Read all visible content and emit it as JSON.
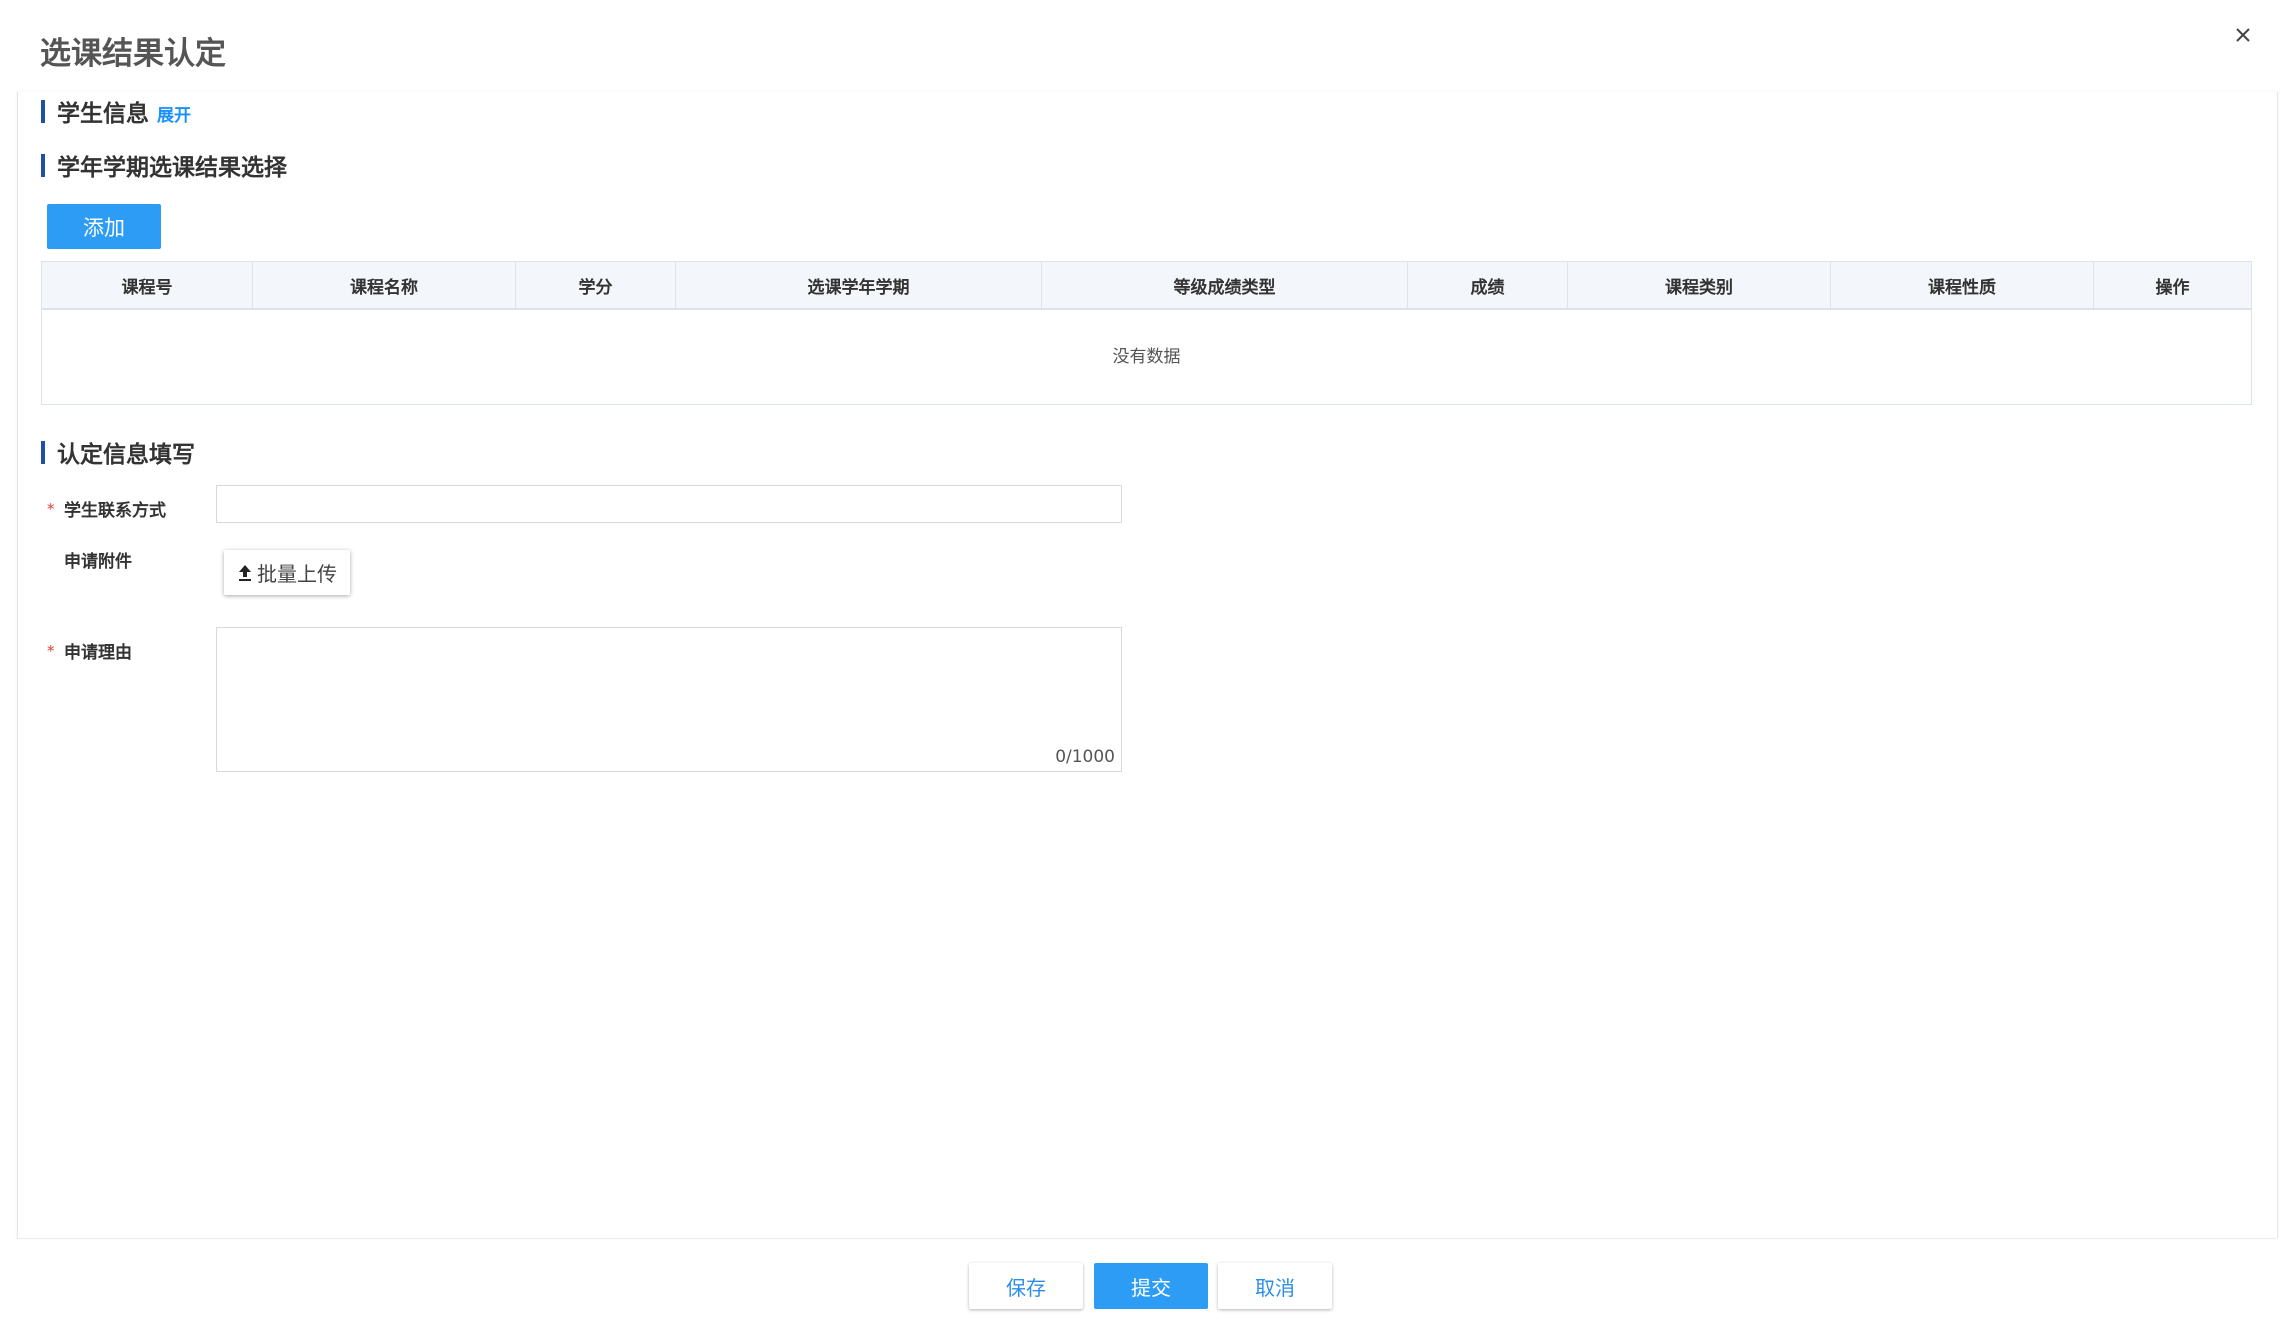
{
  "modal": {
    "title": "选课结果认定"
  },
  "sections": {
    "student_info": {
      "title": "学生信息",
      "expand_label": "展开"
    },
    "course_selection": {
      "title": "学年学期选课结果选择",
      "add_label": "添加"
    },
    "certification": {
      "title": "认定信息填写"
    }
  },
  "table": {
    "columns": [
      "课程号",
      "课程名称",
      "学分",
      "选课学年学期",
      "等级成绩类型",
      "成绩",
      "课程类别",
      "课程性质",
      "操作"
    ],
    "empty_text": "没有数据"
  },
  "form": {
    "required_mark": "*",
    "contact": {
      "label": "学生联系方式",
      "value": ""
    },
    "attachment": {
      "label": "申请附件",
      "upload_label": "批量上传"
    },
    "reason": {
      "label": "申请理由",
      "value": "",
      "counter": "0/1000"
    }
  },
  "footer": {
    "save_label": "保存",
    "submit_label": "提交",
    "cancel_label": "取消"
  },
  "icons": {
    "close": "close-icon",
    "upload": "upload-icon"
  },
  "colors": {
    "primary": "#2d9cf4",
    "section_bar": "#1f4fa8",
    "link": "#1890ff",
    "required": "#e53935"
  }
}
